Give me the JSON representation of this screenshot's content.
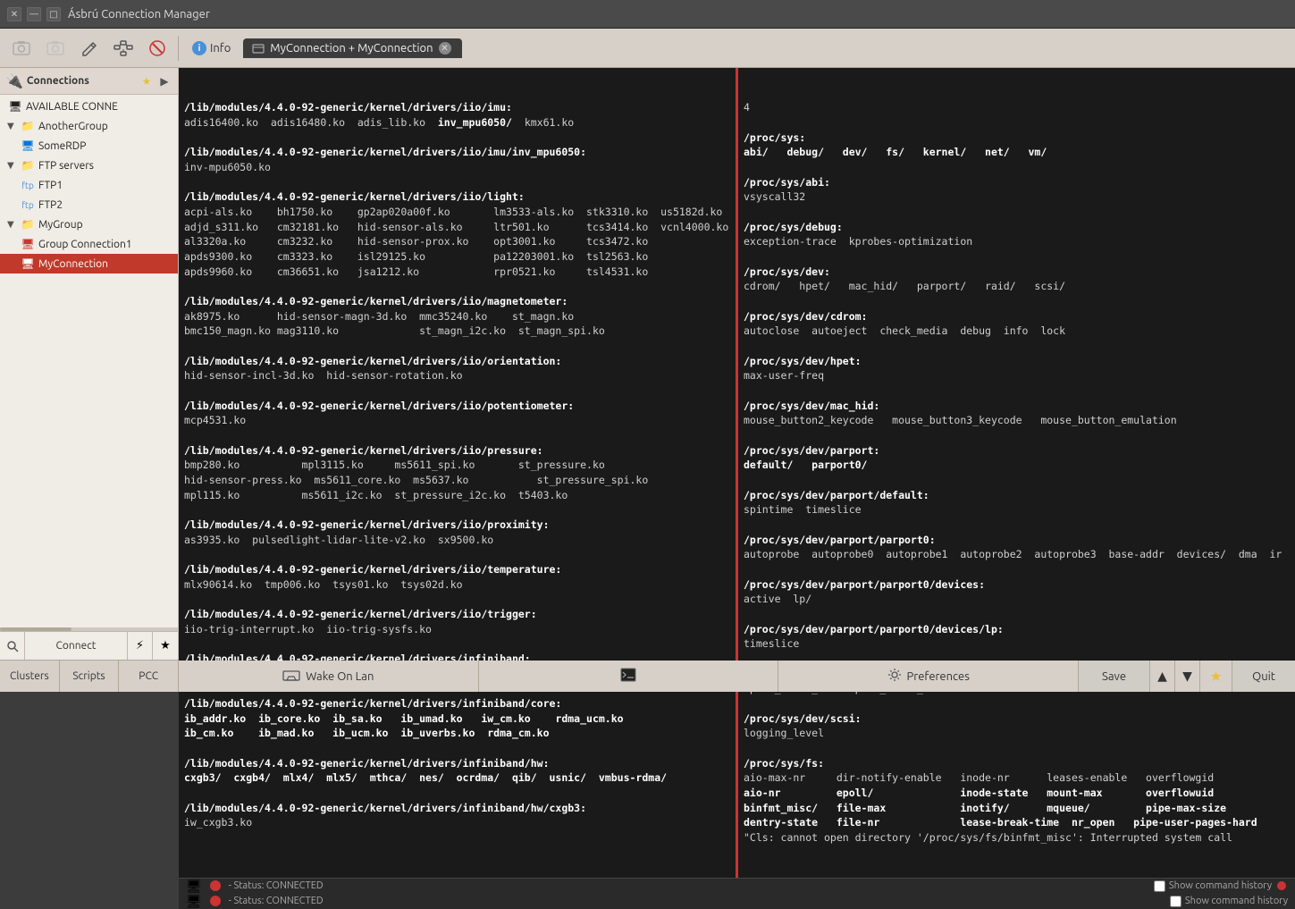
{
  "app": {
    "title": "Ásbrú Connection Manager"
  },
  "titlebar": {
    "close": "✕",
    "minimize": "—",
    "maximize": "□"
  },
  "toolbar": {
    "buttons": [
      {
        "name": "screenshot-btn",
        "icon": "📷",
        "disabled": false
      },
      {
        "name": "screenshot2-btn",
        "icon": "🖼",
        "disabled": true
      },
      {
        "name": "edit-btn",
        "icon": "✏️",
        "disabled": false
      },
      {
        "name": "network-btn",
        "icon": "🔗",
        "disabled": false
      },
      {
        "name": "stop-btn",
        "icon": "🚫",
        "disabled": false
      }
    ]
  },
  "tabs": {
    "info_label": "Info",
    "connection_label": "MyConnection + MyConnection"
  },
  "sidebar": {
    "header_label": "Connections",
    "items": [
      {
        "id": "available",
        "label": "AVAILABLE CONNE",
        "indent": 1,
        "type": "header",
        "icon": "🖥"
      },
      {
        "id": "anothergroup",
        "label": "AnotherGroup",
        "indent": 1,
        "type": "group",
        "arrow": "▼"
      },
      {
        "id": "somerdp",
        "label": "SomeRDP",
        "indent": 2,
        "type": "rdp"
      },
      {
        "id": "ftpservers",
        "label": "FTP servers",
        "indent": 1,
        "type": "group",
        "arrow": "▼"
      },
      {
        "id": "ftp1",
        "label": "FTP1",
        "indent": 2,
        "type": "ftp"
      },
      {
        "id": "ftp2",
        "label": "FTP2",
        "indent": 2,
        "type": "ftp"
      },
      {
        "id": "mygroup",
        "label": "MyGroup",
        "indent": 1,
        "type": "group",
        "arrow": "▼"
      },
      {
        "id": "groupconn1",
        "label": "Group Connection1",
        "indent": 2,
        "type": "ssh"
      },
      {
        "id": "myconnection",
        "label": "MyConnection",
        "indent": 2,
        "type": "ssh",
        "selected": true
      }
    ]
  },
  "terminal_left": {
    "content": "/lib/modules/4.4.0-92-generic/kernel/drivers/iio/imu:\nadis16400.ko  adis16480.ko  adis_lib.ko  inv_mpu6050/  kmx61.ko\n\n/lib/modules/4.4.0-92-generic/kernel/drivers/iio/imu/inv_mpu6050:\ninv-mpu6050.ko\n\n/lib/modules/4.4.0-92-generic/kernel/drivers/iio/light:\nacpi-als.ko    bh1750.ko    gp2ap020a00f.ko       lm3533-als.ko  stk3310.ko  us5182d.ko\nadjd_s311.ko   cm32181.ko   hid-sensor-als.ko     ltr501.ko      tcs3414.ko  vcnl4000.ko\nal3320a.ko     cm3232.ko    hid-sensor-prox.ko    opt3001.ko     tcs3472.ko\napds9300.ko    cm3323.ko    isl29125.ko           pa12203001.ko  tsl2563.ko\napds9960.ko    cm36651.ko   jsa1212.ko            rpr0521.ko     tsl4531.ko\n\n/lib/modules/4.4.0-92-generic/kernel/drivers/iio/magnetometer:\nak8975.ko      hid-sensor-magn-3d.ko  mmc35240.ko    st_magn.ko\nbmc150_magn.ko mag3110.ko             st_magn_i2c.ko  st_magn_spi.ko\n\n/lib/modules/4.4.0-92-generic/kernel/drivers/iio/orientation:\nhid-sensor-incl-3d.ko  hid-sensor-rotation.ko\n\n/lib/modules/4.4.0-92-generic/kernel/drivers/iio/potentiometer:\nmcp4531.ko\n\n/lib/modules/4.4.0-92-generic/kernel/drivers/iio/pressure:\nbmp280.ko          mpl3115.ko     ms5611_spi.ko       st_pressure.ko\nhid-sensor-press.ko  ms5611_core.ko  ms5637.ko           st_pressure_spi.ko\nmpl115.ko          ms5611_i2c.ko  st_pressure_i2c.ko  t5403.ko\n\n/lib/modules/4.4.0-92-generic/kernel/drivers/iio/proximity:\nas3935.ko  pulsedlight-lidar-lite-v2.ko  sx9500.ko\n\n/lib/modules/4.4.0-92-generic/kernel/drivers/iio/temperature:\nmlx90614.ko  tmp006.ko  tsys01.ko  tsys02d.ko\n\n/lib/modules/4.4.0-92-generic/kernel/drivers/iio/trigger:\niio-trig-interrupt.ko  iio-trig-sysfs.ko\n\n/lib/modules/4.4.0-92-generic/kernel/drivers/infiniband:\ncore/  hw/  ulp/\n\n/lib/modules/4.4.0-92-generic/kernel/drivers/infiniband/core:\nib_addr.ko  ib_core.ko  ib_sa.ko   ib_umad.ko   iw_cm.ko    rdma_ucm.ko\nib_cm.ko    ib_mad.ko   ib_ucm.ko  ib_uverbs.ko  rdma_cm.ko\n\n/lib/modules/4.4.0-92-generic/kernel/drivers/infiniband/hw:\ncxgb3/  cxgb4/  mlx4/  mlx5/  mthca/  nes/  ocrdma/  qib/  usnic/  vmbus-rdma/\n\n/lib/modules/4.4.0-92-generic/kernel/drivers/infiniband/hw/cxgb3:\niw_cxgb3.ko"
  },
  "terminal_right": {
    "content": "4\n\n/proc/sys:\nabi/   debug/   dev/   fs/   kernel/   net/   vm/\n\n/proc/sys/abi:\nvsyscall32\n\n/proc/sys/debug:\nexception-trace  kprobes-optimization\n\n/proc/sys/dev:\ncdrom/   hpet/   mac_hid/   parport/   raid/   scsi/\n\n/proc/sys/dev/cdrom:\nautoclose  autoeject  check_media  debug  info  lock\n\n/proc/sys/dev/hpet:\nmax-user-freq\n\n/proc/sys/dev/mac_hid:\nmouse_button2_keycode   mouse_button3_keycode   mouse_button_emulation\n\n/proc/sys/dev/parport:\ndefault/   parport0/\n\n/proc/sys/dev/parport/default:\nspintime  timeslice\n\n/proc/sys/dev/parport/parport0:\nautoprobe  autoprobe0  autoprobe1  autoprobe2  autoprobe3  base-addr  devices/  dma  ir\n\n/proc/sys/dev/parport/parport0/devices:\nactive  lp/\n\n/proc/sys/dev/parport/parport0/devices/lp:\ntimeslice\n\n/proc/sys/dev/raid:\nspeed_limit_max  speed_limit_min\n\n/proc/sys/dev/scsi:\nlogging_level\n\n/proc/sys/fs:\naio-max-nr     dir-notify-enable   inode-nr      leases-enable   overflowgid\naio-nr         epoll/              inode-state   mount-max       overflowuid\nbinfmt_misc/   file-max            inotify/      mqueue/         pipe-max-size\ndentry-state   file-nr             lease-break-time  nr_open   pipe-user-pages-hard\n\"Cls: cannot open directory '/proc/sys/fs/binfmt_misc': Interrupted system call"
  },
  "status": {
    "left_icon": "🔴",
    "left_text": "- Status: CONNECTED",
    "show_history_left": "Show command history",
    "right_icon": "🔴",
    "right_text": "- Status: CONNECTED",
    "show_history_right": "Show command history"
  },
  "bottom_bar": {
    "clusters_label": "Clusters",
    "scripts_label": "Scripts",
    "pcc_label": "PCC",
    "network_label": "Wake On Lan",
    "prefs_label": "Preferences",
    "save_label": "Save",
    "quit_label": "Quit",
    "connect_label": "Connect",
    "quick_connect_label": "⚡",
    "bookmark_label": "★"
  }
}
